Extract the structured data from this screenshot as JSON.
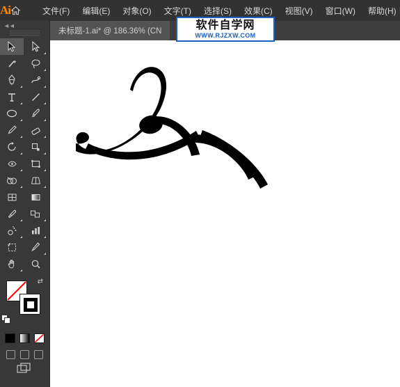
{
  "app": {
    "logo_text": "Ai",
    "home_icon": "home-icon"
  },
  "menu": {
    "items": [
      {
        "label": "文件(F)"
      },
      {
        "label": "编辑(E)"
      },
      {
        "label": "对象(O)"
      },
      {
        "label": "文字(T)"
      },
      {
        "label": "选择(S)"
      },
      {
        "label": "效果(C)"
      },
      {
        "label": "视图(V)"
      },
      {
        "label": "窗口(W)"
      },
      {
        "label": "帮助(H)"
      }
    ]
  },
  "tabs": {
    "document": "未标题-1.ai* @ 186.36% (CN"
  },
  "toolbar": {
    "collapse_label": "◄◄",
    "tools": [
      {
        "name": "selection-tool",
        "selected": true
      },
      {
        "name": "direct-selection-tool",
        "selected": false
      },
      {
        "name": "magic-wand-tool",
        "selected": false
      },
      {
        "name": "lasso-tool",
        "selected": false
      },
      {
        "name": "pen-tool",
        "selected": false
      },
      {
        "name": "curvature-tool",
        "selected": false
      },
      {
        "name": "type-tool",
        "selected": false
      },
      {
        "name": "line-segment-tool",
        "selected": false
      },
      {
        "name": "ellipse-tool",
        "selected": false
      },
      {
        "name": "paintbrush-tool",
        "selected": false
      },
      {
        "name": "shaper-tool",
        "selected": false
      },
      {
        "name": "eraser-tool",
        "selected": false
      },
      {
        "name": "rotate-tool",
        "selected": false
      },
      {
        "name": "scale-tool",
        "selected": false
      },
      {
        "name": "width-tool",
        "selected": false
      },
      {
        "name": "free-transform-tool",
        "selected": false
      },
      {
        "name": "shape-builder-tool",
        "selected": false
      },
      {
        "name": "perspective-grid-tool",
        "selected": false
      },
      {
        "name": "mesh-tool",
        "selected": false
      },
      {
        "name": "gradient-tool",
        "selected": false
      },
      {
        "name": "eyedropper-tool",
        "selected": false
      },
      {
        "name": "blend-tool",
        "selected": false
      },
      {
        "name": "symbol-sprayer-tool",
        "selected": false
      },
      {
        "name": "column-graph-tool",
        "selected": false
      },
      {
        "name": "artboard-tool",
        "selected": false
      },
      {
        "name": "slice-tool",
        "selected": false
      },
      {
        "name": "hand-tool",
        "selected": false
      },
      {
        "name": "zoom-tool",
        "selected": false
      }
    ],
    "color": {
      "fill_color": "#ffffff",
      "fill_is_none": true,
      "stroke_color": "#000000",
      "none_slash_color": "#ff0000",
      "swatches": [
        {
          "name": "color-swatch",
          "color": "#000000"
        },
        {
          "name": "gradient-swatch",
          "color": "#ffffff"
        },
        {
          "name": "none-swatch",
          "color": "#ffffff"
        }
      ]
    }
  },
  "canvas": {
    "background": "#ffffff",
    "artwork_name": "brush-stroke-artwork",
    "artwork_color": "#000000"
  },
  "watermark": {
    "title": "软件自学网",
    "url": "WWW.RJZXW.COM",
    "border_color": "#1b5fc1",
    "url_color": "#1b5fc1"
  }
}
